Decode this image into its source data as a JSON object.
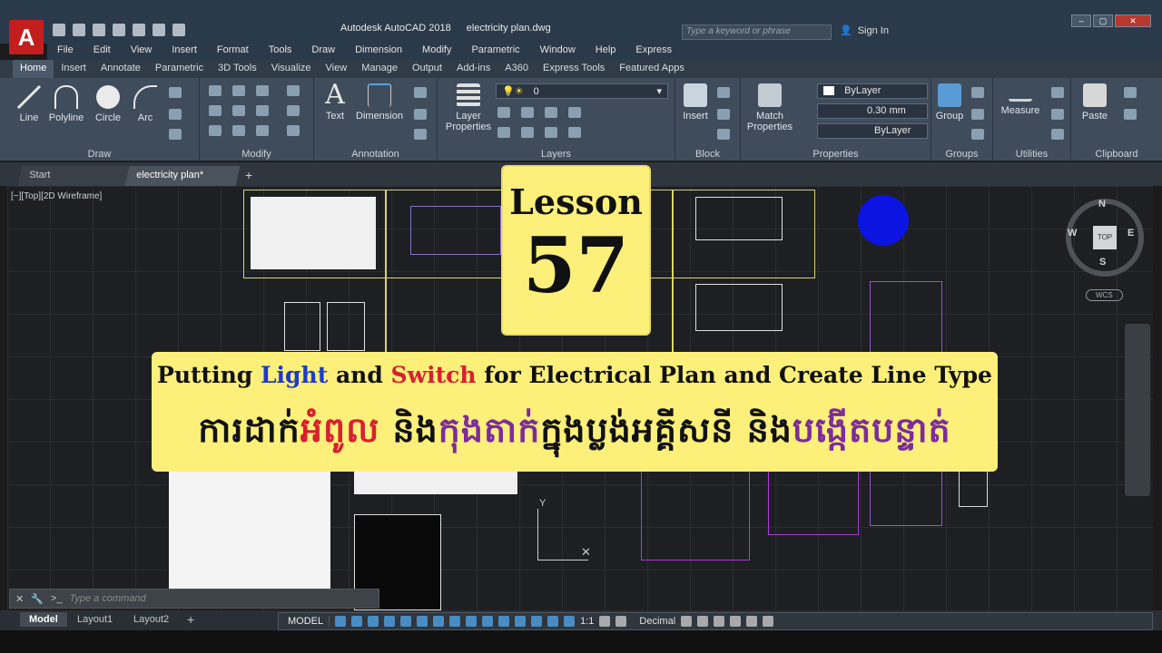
{
  "app": {
    "logo": "A",
    "title": "Autodesk AutoCAD 2018",
    "filename": "electricity plan.dwg",
    "search_placeholder": "Type a keyword or phrase",
    "sign_in": "Sign In"
  },
  "menu": [
    "File",
    "Edit",
    "View",
    "Insert",
    "Format",
    "Tools",
    "Draw",
    "Dimension",
    "Modify",
    "Parametric",
    "Window",
    "Help",
    "Express"
  ],
  "ribbon_tabs": [
    "Home",
    "Insert",
    "Annotate",
    "Parametric",
    "3D Tools",
    "Visualize",
    "View",
    "Manage",
    "Output",
    "Add-ins",
    "A360",
    "Express Tools",
    "Featured Apps"
  ],
  "panels": {
    "draw": {
      "label": "Draw",
      "tools": [
        "Line",
        "Polyline",
        "Circle",
        "Arc"
      ]
    },
    "modify": {
      "label": "Modify"
    },
    "annotation": {
      "label": "Annotation",
      "tools": [
        "Text",
        "Dimension"
      ]
    },
    "layers": {
      "label": "Layers",
      "tool": "Layer Properties",
      "current_layer": "0"
    },
    "block": {
      "label": "Block",
      "tool": "Insert"
    },
    "properties": {
      "label": "Properties",
      "tool": "Match Properties",
      "color": "ByLayer",
      "lineweight": "0.30 mm",
      "linetype": "ByLayer"
    },
    "groups": {
      "label": "Groups",
      "tool": "Group"
    },
    "utilities": {
      "label": "Utilities",
      "tool": "Measure"
    },
    "clipboard": {
      "label": "Clipboard",
      "tool": "Paste"
    }
  },
  "doc_tabs": [
    "Start",
    "electricity plan*"
  ],
  "viewport_label": "[−][Top][2D Wireframe]",
  "viewcube": {
    "face": "TOP",
    "n": "N",
    "s": "S",
    "e": "E",
    "w": "W",
    "wcs": "WCS"
  },
  "overlay": {
    "lesson_word": "Lesson",
    "lesson_number": "57",
    "title_parts": [
      {
        "text": "Putting ",
        "style": "normal"
      },
      {
        "text": "Light",
        "style": "blue"
      },
      {
        "text": " and ",
        "style": "normal"
      },
      {
        "text": "Switch",
        "style": "red"
      },
      {
        "text": " for Electrical Plan and Create Line Type",
        "style": "normal"
      }
    ],
    "khmer_parts": [
      {
        "text": "ការដាក់",
        "style": "black"
      },
      {
        "text": "អំពូល",
        "style": "red"
      },
      {
        "text": "  និង",
        "style": "black"
      },
      {
        "text": "កុងតាក់",
        "style": "purple"
      },
      {
        "text": "ក្នុងប្លង់អគ្គីសនី  និង",
        "style": "black"
      },
      {
        "text": "បង្កើតបន្ទាត់",
        "style": "purple"
      }
    ]
  },
  "command_line": {
    "placeholder": "Type a command"
  },
  "layout_tabs": [
    "Model",
    "Layout1",
    "Layout2"
  ],
  "status": {
    "model": "MODEL",
    "scale": "1:1",
    "units": "Decimal"
  },
  "colors": {
    "overlay_bg": "#fdf07a",
    "blue": "#1f3bc9",
    "red": "#d82030",
    "purple": "#7d2c9a",
    "app_red": "#c21e1e"
  }
}
